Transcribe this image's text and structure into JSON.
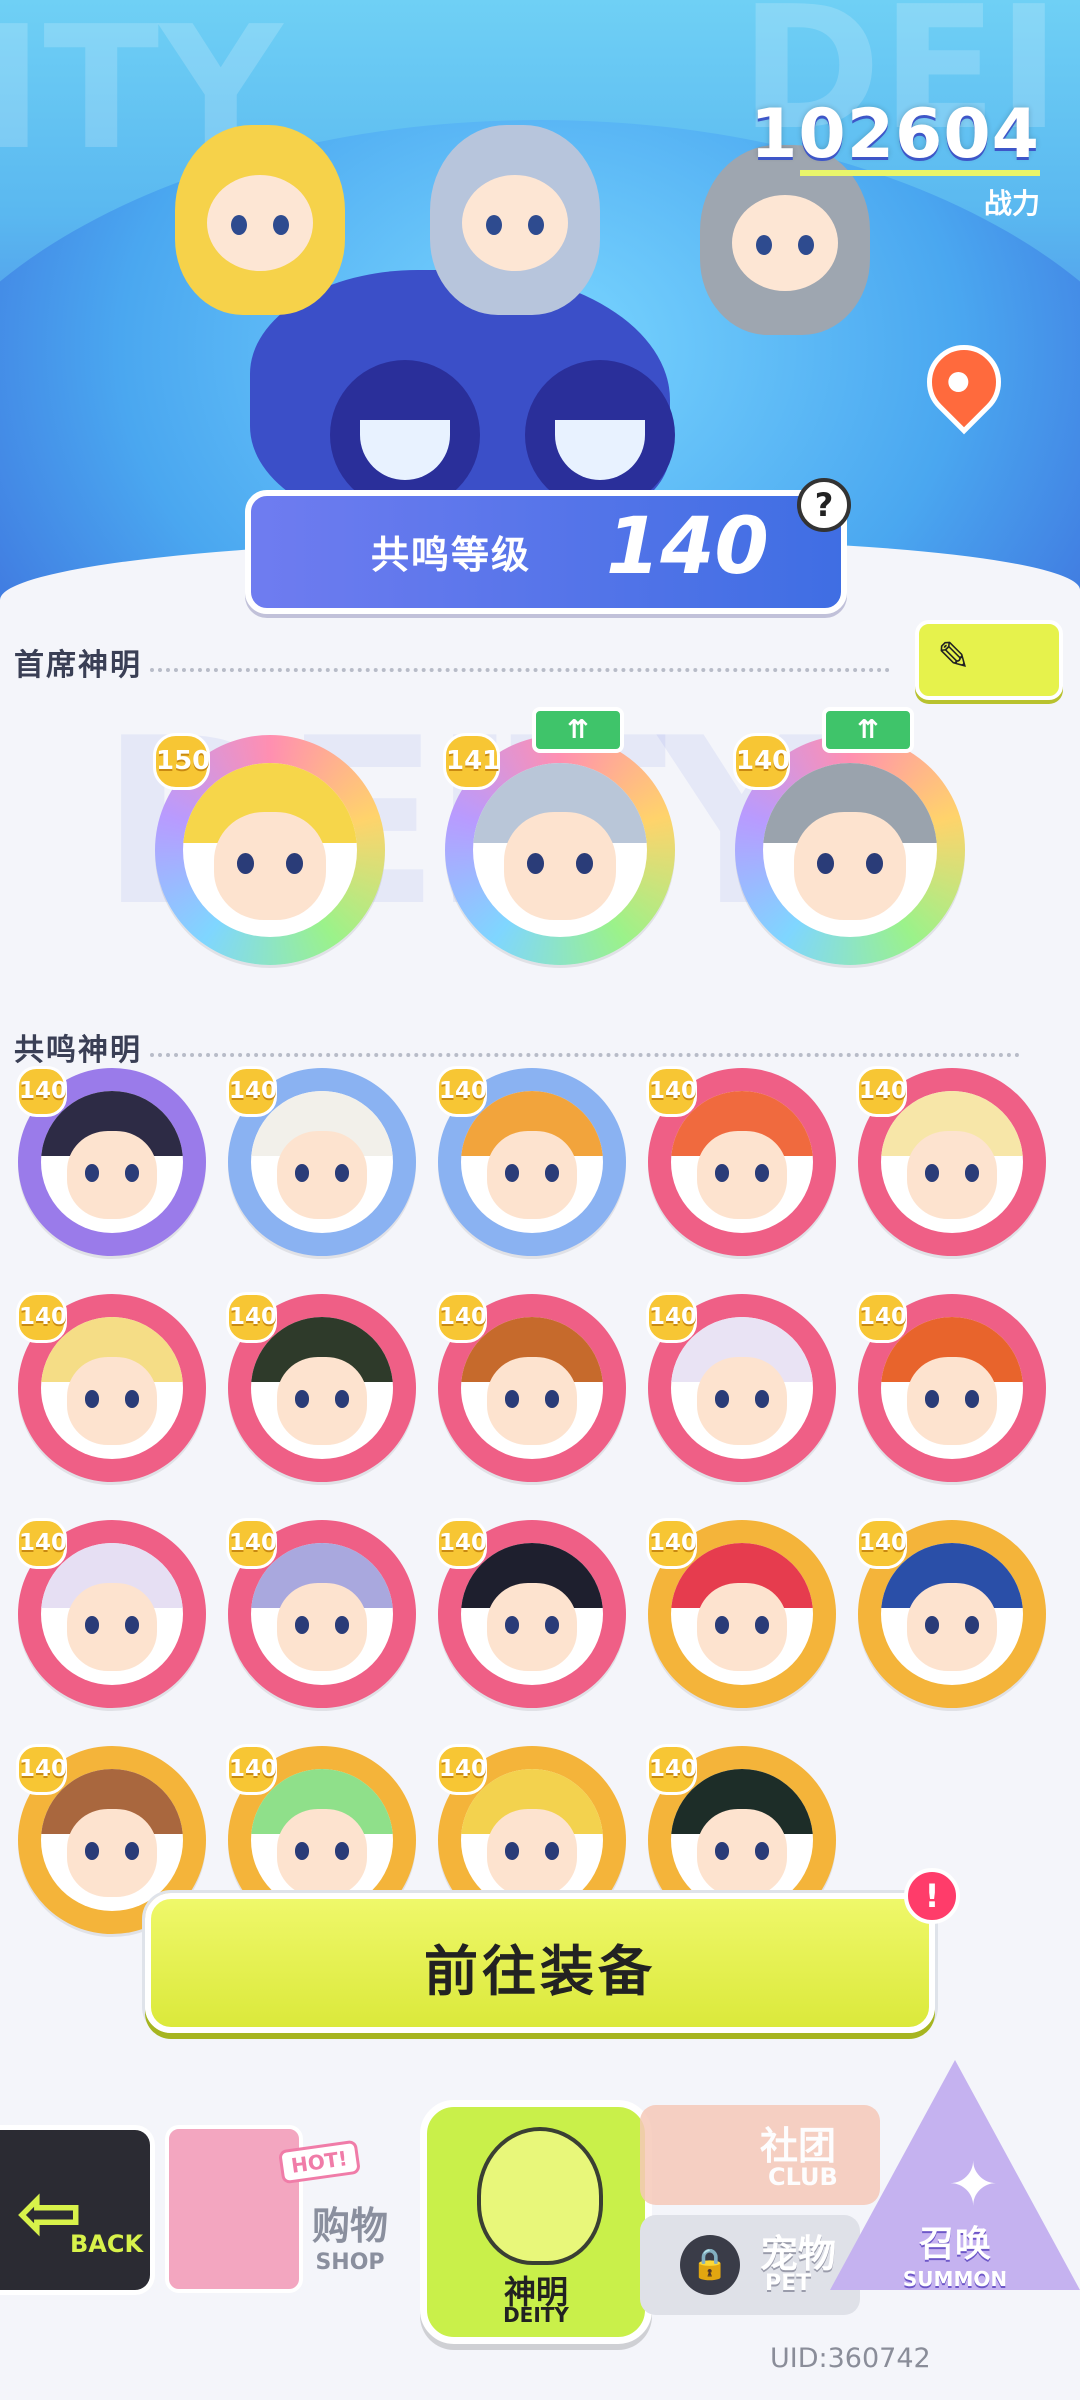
{
  "header": {
    "bg_word_left": "ITY",
    "bg_word_right": "DEI",
    "power_value": "102604",
    "power_label": "战力",
    "resonance_label": "共鸣等级",
    "resonance_level": "140"
  },
  "chief_section": {
    "title": "首席神明",
    "watermark": "DEITY",
    "deities": [
      {
        "level": "150",
        "upgrade": false,
        "hair": "#f6d64a",
        "ring": "rainbow"
      },
      {
        "level": "141",
        "upgrade": true,
        "hair": "#b9c6d8",
        "ring": "rainbow"
      },
      {
        "level": "140",
        "upgrade": true,
        "hair": "#9aa3ad",
        "ring": "rainbow"
      }
    ]
  },
  "resonance_section": {
    "title": "共鸣神明",
    "deities": [
      {
        "level": "140",
        "hair": "#2d2b45",
        "ring": "#9a7bea"
      },
      {
        "level": "140",
        "hair": "#f2f0ea",
        "ring": "#8ab2f2"
      },
      {
        "level": "140",
        "hair": "#f2a43c",
        "ring": "#8ab2f2"
      },
      {
        "level": "140",
        "hair": "#f06a3e",
        "ring": "#ef5f86"
      },
      {
        "level": "140",
        "hair": "#f7e6a8",
        "ring": "#ef5f86"
      },
      {
        "level": "140",
        "hair": "#f5dd86",
        "ring": "#ef5f86"
      },
      {
        "level": "140",
        "hair": "#2e3a2a",
        "ring": "#ef5f86"
      },
      {
        "level": "140",
        "hair": "#c66a2c",
        "ring": "#ef5f86"
      },
      {
        "level": "140",
        "hair": "#e9e3f4",
        "ring": "#ef5f86"
      },
      {
        "level": "140",
        "hair": "#e8642c",
        "ring": "#ef5f86"
      },
      {
        "level": "140",
        "hair": "#e6dff3",
        "ring": "#ef5f86"
      },
      {
        "level": "140",
        "hair": "#a9a8de",
        "ring": "#ef5f86"
      },
      {
        "level": "140",
        "hair": "#1e1f2e",
        "ring": "#ef5f86"
      },
      {
        "level": "140",
        "hair": "#e63c4e",
        "ring": "#f4b43a"
      },
      {
        "level": "140",
        "hair": "#2a4fa8",
        "ring": "#f4b43a"
      },
      {
        "level": "140",
        "hair": "#a9673e",
        "ring": "#f4b43a"
      },
      {
        "level": "140",
        "hair": "#8fe08a",
        "ring": "#f4b43a"
      },
      {
        "level": "140",
        "hair": "#f3d24e",
        "ring": "#f4b43a"
      },
      {
        "level": "140",
        "hair": "#1d2d28",
        "ring": "#f4b43a"
      }
    ]
  },
  "equip_button": {
    "label": "前往装备",
    "alert": "!"
  },
  "nav": {
    "back": {
      "arrow": "⇦",
      "label": "BACK"
    },
    "shop": {
      "cn": "购物",
      "en": "SHOP",
      "hot": "HOT!"
    },
    "deity": {
      "cn": "神明",
      "en": "DEITY"
    },
    "club": {
      "cn": "社团",
      "en": "CLUB"
    },
    "pet": {
      "cn": "宠物",
      "en": "PET"
    },
    "summon": {
      "cn": "召唤",
      "en": "SUMMON"
    }
  },
  "uid": "UID:360742",
  "colors": {
    "accent_green": "#dbe93b",
    "header_blue": "#4a86e6",
    "pink_ring": "#ef5f86",
    "gold_ring": "#f4b43a"
  },
  "icons": [
    "question-icon",
    "edit-pencil-icon",
    "location-pin-icon",
    "upgrade-arrows-icon",
    "lock-icon",
    "star-icon"
  ]
}
